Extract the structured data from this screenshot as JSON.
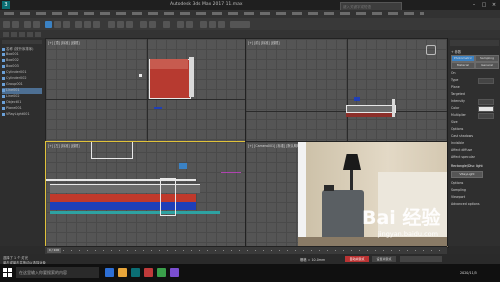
{
  "app": {
    "title": "Autodesk 3ds Max 2017    11.max",
    "search_placeholder": "键入关键字或短语"
  },
  "scene_explorer": {
    "items": [
      "名称 (按升序排序)",
      "Box001",
      "Box002",
      "Box003",
      "Cylinder001",
      "Cylinder002",
      "Group001",
      "Line001",
      "Line002",
      "Object01",
      "Plane001",
      "VRayLight001"
    ]
  },
  "viewports": {
    "top_left": {
      "label": "[+] [顶] [标准] [线框]"
    },
    "top_right": {
      "label": "[+] [前] [标准] [线框]"
    },
    "bottom_left": {
      "label": "[+] [左] [标准] [线框]"
    },
    "bottom_right": {
      "label": "[+] [Camera001] [标准] [默认明暗处理]"
    }
  },
  "command_panel": {
    "rows": [
      "+ 参数",
      "Photometric",
      "Sampling",
      "Material",
      "General",
      "On",
      "Type",
      "Plane",
      "Targeted",
      "Intensity",
      "Color",
      "Multiplier",
      "Size",
      "Options",
      "Cast shadows",
      "Invisible",
      "Affect diffuse",
      "Affect specular",
      "Rectangle/Disc light",
      "VRayLight",
      "Options",
      "Sampling",
      "Viewport",
      "Advanced options"
    ],
    "buttons": [
      "On",
      "Plane",
      "Color",
      "Exclude"
    ]
  },
  "timeline": {
    "frame": "0 / 100"
  },
  "status": {
    "selection": "选择了 1 个 灯光",
    "prompt": "单击或单击并拖动以选择对象",
    "grid": "栅格 = 10.0mm",
    "autokey": "自动关键点",
    "set_key": "设置关键点"
  },
  "watermark": {
    "logo": "Bai 经验",
    "url": "jingyan.baidu.com"
  },
  "taskbar": {
    "search_text": "在这里输入你要搜索的内容",
    "time": "2020/11/5"
  },
  "colors": {
    "accent_blue": "#3b82c4",
    "bed_red": "#c0392b",
    "bed_blue": "#1f3fb8",
    "selection_white": "#e8e8e8"
  }
}
